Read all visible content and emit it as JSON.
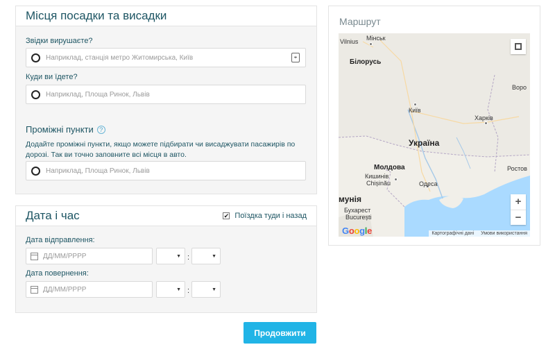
{
  "pickup": {
    "title": "Місця посадки та висадки",
    "from_label": "Звідки вирушаєте?",
    "from_placeholder": "Наприклад, станція метро Житомирська, Київ",
    "to_label": "Куди ви їдете?",
    "to_placeholder": "Наприклад, Площа Ринок, Львів",
    "stops_title": "Проміжні пункти",
    "stops_desc": "Додайте проміжні пункти, якщо можете підбирати чи висаджувати пасажирів по дорозі. Так ви точно заповните всі місця в авто.",
    "stop_placeholder": "Наприклад, Площа Ринок, Львів"
  },
  "datetime": {
    "title": "Дата і час",
    "round_trip_label": "Поїздка туди і назад",
    "round_trip_checked": true,
    "departure_label": "Дата відправлення:",
    "return_label": "Дата повернення:",
    "date_placeholder": "ДД/ММ/РРРР",
    "time_separator": ":"
  },
  "continue_label": "Продовжити",
  "route": {
    "title": "Маршрут",
    "map_labels": {
      "vilnius": "Vilnius",
      "minsk": "Мінськ",
      "belarus": "Білорусь",
      "kyiv": "Київ",
      "kharkiv": "Харків",
      "ukraine": "Україна",
      "voronezh": "Воро",
      "moldova": "Молдова",
      "chisinau_ua": "Кишинів",
      "chisinau": "Chișinău",
      "odesa": "Одеса",
      "rostov": "Ростов",
      "romania": "мунія",
      "bucharest_ua": "Бухарест",
      "bucharest": "București"
    },
    "logo": "Google",
    "attrib_data": "Картографічні дані",
    "attrib_terms": "Умови використання",
    "zoom_in": "+",
    "zoom_out": "−"
  }
}
